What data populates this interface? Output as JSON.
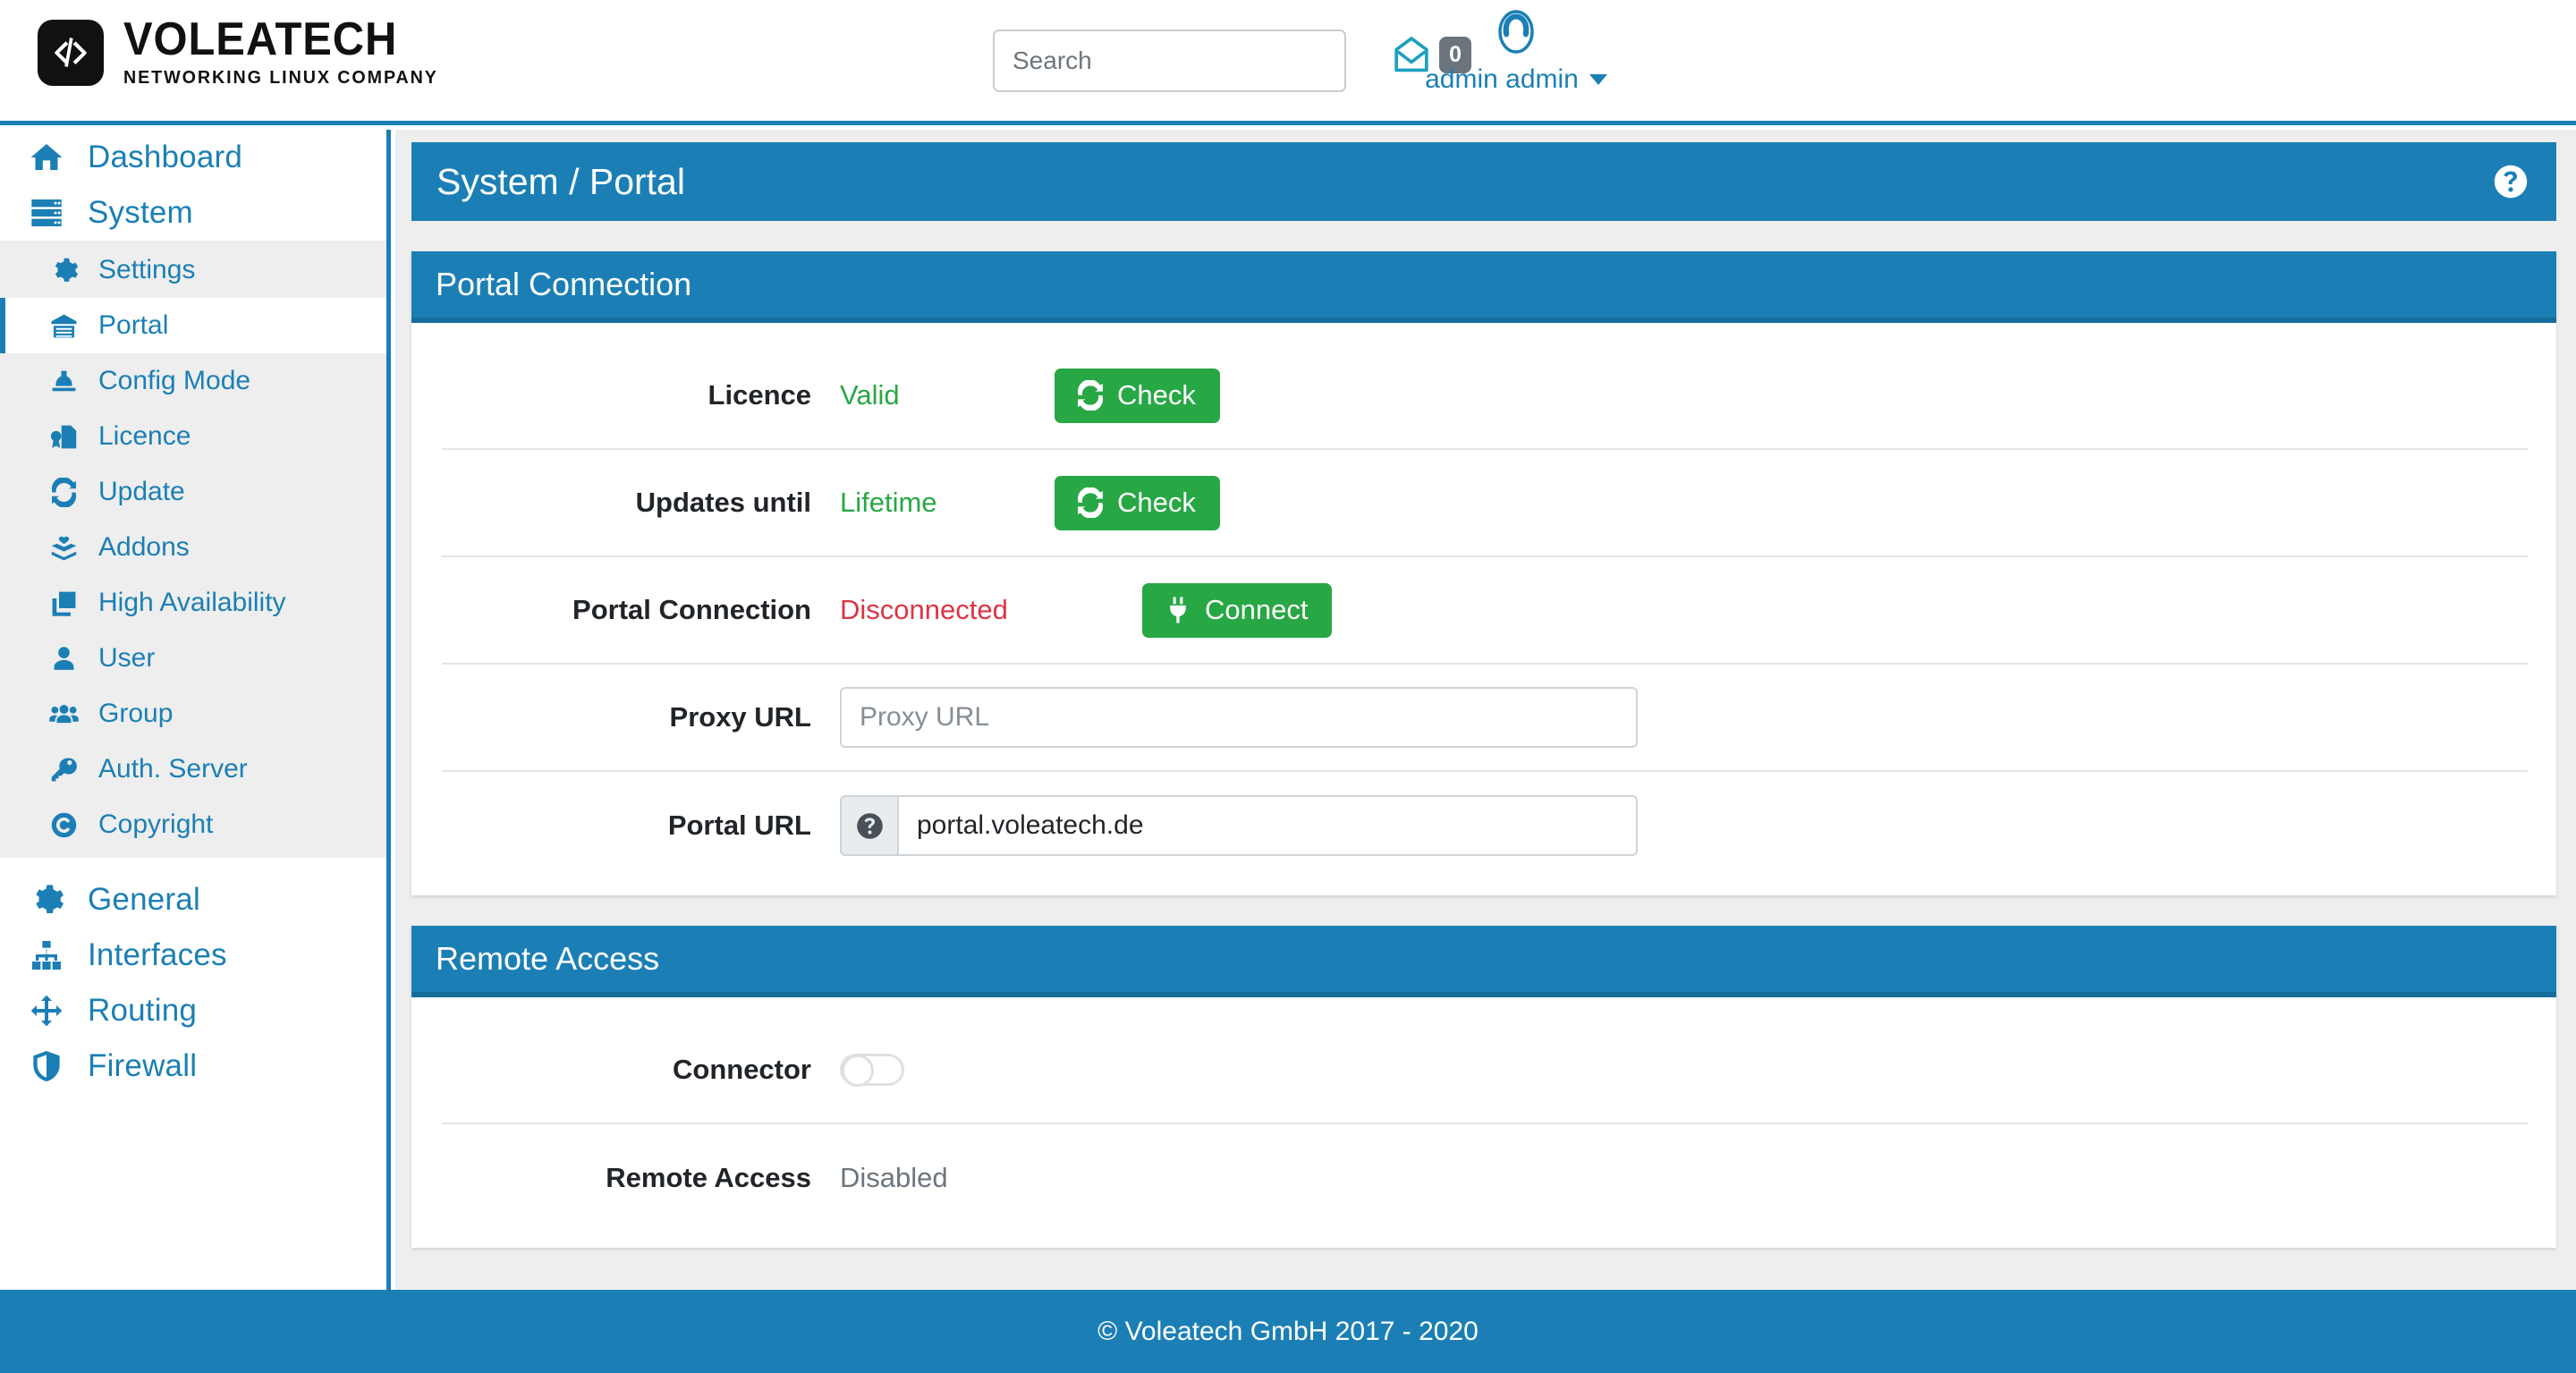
{
  "topnav": {
    "brand_name": "VOLEATECH",
    "brand_tagline": "NETWORKING LINUX COMPANY",
    "brand_icon": "code-brackets-icon",
    "search_placeholder": "Search",
    "search_value": "",
    "mail_icon": "envelope-open-icon",
    "mail_badge": "0",
    "avatar_icon": "user-avatar-icon",
    "user_name": "admin admin",
    "caret_icon": "caret-down-icon"
  },
  "sidebar": {
    "items": [
      {
        "label": "Dashboard",
        "icon": "home-icon"
      },
      {
        "label": "System",
        "icon": "server-icon"
      }
    ],
    "submenu": [
      {
        "label": "Settings",
        "icon": "gear-icon",
        "active": false
      },
      {
        "label": "Portal",
        "icon": "store-icon",
        "active": true
      },
      {
        "label": "Config Mode",
        "icon": "hard-hat-icon",
        "active": false
      },
      {
        "label": "Licence",
        "icon": "certificate-icon",
        "active": false
      },
      {
        "label": "Update",
        "icon": "sync-icon",
        "active": false
      },
      {
        "label": "Addons",
        "icon": "open-box-icon",
        "active": false
      },
      {
        "label": "High Availability",
        "icon": "clone-icon",
        "active": false
      },
      {
        "label": "User",
        "icon": "user-icon",
        "active": false
      },
      {
        "label": "Group",
        "icon": "users-icon",
        "active": false
      },
      {
        "label": "Auth. Server",
        "icon": "key-icon",
        "active": false
      },
      {
        "label": "Copyright",
        "icon": "copyright-icon",
        "active": false
      }
    ],
    "items_after": [
      {
        "label": "General",
        "icon": "gear-icon"
      },
      {
        "label": "Interfaces",
        "icon": "sitemap-icon"
      },
      {
        "label": "Routing",
        "icon": "arrows-move-icon"
      },
      {
        "label": "Firewall",
        "icon": "shield-icon"
      }
    ]
  },
  "page": {
    "title": "System / Portal",
    "help_icon": "help-circle-icon"
  },
  "portal_connection": {
    "title": "Portal Connection",
    "rows": {
      "licence_label": "Licence",
      "licence_value": "Valid",
      "licence_button": "Check",
      "licence_button_icon": "sync-icon",
      "updates_label": "Updates until",
      "updates_value": "Lifetime",
      "updates_button": "Check",
      "updates_button_icon": "sync-icon",
      "connection_label": "Portal Connection",
      "connection_value": "Disconnected",
      "connection_button": "Connect",
      "connection_button_icon": "plug-icon",
      "proxy_label": "Proxy URL",
      "proxy_placeholder": "Proxy URL",
      "proxy_value": "",
      "portal_url_label": "Portal URL",
      "portal_url_value": "portal.voleatech.de",
      "portal_url_addon_icon": "help-circle-icon"
    }
  },
  "remote_access": {
    "title": "Remote Access",
    "connector_label": "Connector",
    "connector_state": "off",
    "remote_access_label": "Remote Access",
    "remote_access_value": "Disabled"
  },
  "footer": {
    "copyright": "© Voleatech GmbH 2017 - 2020"
  },
  "colors": {
    "brand_blue": "#1b7fb5",
    "success_green": "#28a745",
    "danger_red": "#dc3545",
    "muted_gray": "#6c757d",
    "panel_bg": "#eeeeee"
  }
}
